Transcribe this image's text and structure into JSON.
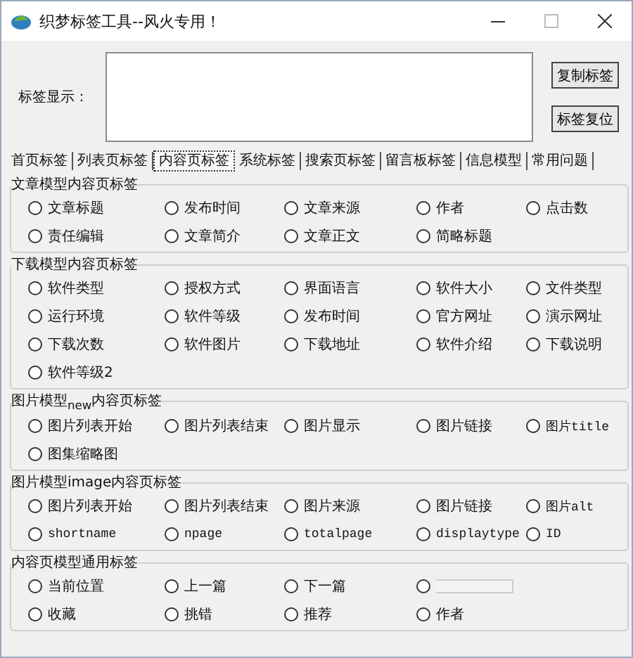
{
  "window": {
    "title": "织梦标签工具--风火专用！"
  },
  "tag_display": {
    "label": "标签显示："
  },
  "buttons": [
    "复制标签",
    "标签复位"
  ],
  "tabs": [
    {
      "label": "首页标签",
      "selected": false
    },
    {
      "label": "列表页标签",
      "selected": false
    },
    {
      "label": "内容页标签",
      "selected": true
    },
    {
      "label": "系统标签",
      "selected": false
    },
    {
      "label": "搜索页标签",
      "selected": false
    },
    {
      "label": "留言板标签",
      "selected": false
    },
    {
      "label": "信息模型",
      "selected": false
    },
    {
      "label": "常用问题",
      "selected": false
    }
  ],
  "groups": [
    {
      "title": "文章模型内容页标签",
      "options": [
        {
          "kind": "text",
          "label": "文章标题",
          "selected": false
        },
        {
          "kind": "text",
          "label": "发布时间",
          "selected": false
        },
        {
          "kind": "text",
          "label": "文章来源",
          "selected": false
        },
        {
          "kind": "text",
          "label": "作者",
          "selected": false
        },
        {
          "kind": "text",
          "label": "点击数",
          "selected": false
        },
        {
          "kind": "text",
          "label": "责任编辑",
          "selected": false
        },
        {
          "kind": "text",
          "label": "文章简介",
          "selected": false
        },
        {
          "kind": "text",
          "label": "文章正文",
          "selected": false
        },
        {
          "kind": "text",
          "label": "简略标题",
          "selected": false
        }
      ]
    },
    {
      "title": "下载模型内容页标签",
      "options": [
        {
          "kind": "text",
          "label": "软件类型",
          "selected": false
        },
        {
          "kind": "text",
          "label": "授权方式",
          "selected": false
        },
        {
          "kind": "text",
          "label": "界面语言",
          "selected": false
        },
        {
          "kind": "text",
          "label": "软件大小",
          "selected": false
        },
        {
          "kind": "text",
          "label": "文件类型",
          "selected": false
        },
        {
          "kind": "text",
          "label": "运行环境",
          "selected": false
        },
        {
          "kind": "text",
          "label": "软件等级",
          "selected": false
        },
        {
          "kind": "text",
          "label": "发布时间",
          "selected": false
        },
        {
          "kind": "text",
          "label": "官方网址",
          "selected": false
        },
        {
          "kind": "text",
          "label": "演示网址",
          "selected": false
        },
        {
          "kind": "text",
          "label": "下载次数",
          "selected": false
        },
        {
          "kind": "text",
          "label": "软件图片",
          "selected": false
        },
        {
          "kind": "text",
          "label": "下载地址",
          "selected": false
        },
        {
          "kind": "text",
          "label": "软件介绍",
          "selected": false
        },
        {
          "kind": "text",
          "label": "下载说明",
          "selected": false
        },
        {
          "kind": "text",
          "label": "软件等级2",
          "selected": false
        }
      ]
    },
    {
      "title": "图片模型$_{new}$内容页标签",
      "options": [
        {
          "kind": "text",
          "label": "图片列表开始",
          "selected": false
        },
        {
          "kind": "text",
          "label": "图片列表结束",
          "selected": false
        },
        {
          "kind": "text",
          "label": "图片显示",
          "selected": false
        },
        {
          "kind": "text",
          "label": "图片链接",
          "selected": false
        },
        {
          "kind": "code",
          "label": "图片title",
          "selected": false
        },
        {
          "kind": "text",
          "label": "图集缩略图",
          "selected": false
        }
      ]
    },
    {
      "title": "图片模型image内容页标签",
      "options": [
        {
          "kind": "text",
          "label": "图片列表开始",
          "selected": false
        },
        {
          "kind": "text",
          "label": "图片列表结束",
          "selected": false
        },
        {
          "kind": "text",
          "label": "图片来源",
          "selected": false
        },
        {
          "kind": "text",
          "label": "图片链接",
          "selected": false
        },
        {
          "kind": "code",
          "label": "图片alt",
          "selected": false
        },
        {
          "kind": "code",
          "label": "shortname",
          "selected": false
        },
        {
          "kind": "code",
          "label": "npage",
          "selected": false
        },
        {
          "kind": "code",
          "label": "totalpage",
          "selected": false
        },
        {
          "kind": "code",
          "label": "displaytype",
          "selected": false
        },
        {
          "kind": "code",
          "label": "ID",
          "selected": false
        }
      ]
    },
    {
      "title": "内容页模型通用标签",
      "options": [
        {
          "kind": "text",
          "label": "当前位置",
          "selected": false
        },
        {
          "kind": "text",
          "label": "上一篇",
          "selected": false
        },
        {
          "kind": "text",
          "label": "下一篇",
          "selected": false
        },
        {
          "kind": "blank",
          "selected": false
        },
        {
          "kind": "empty"
        },
        {
          "kind": "text",
          "label": "收藏",
          "selected": false
        },
        {
          "kind": "text",
          "label": "挑错",
          "selected": false
        },
        {
          "kind": "text",
          "label": "推荐",
          "selected": false
        },
        {
          "kind": "text",
          "label": "作者",
          "selected": false
        }
      ]
    }
  ]
}
